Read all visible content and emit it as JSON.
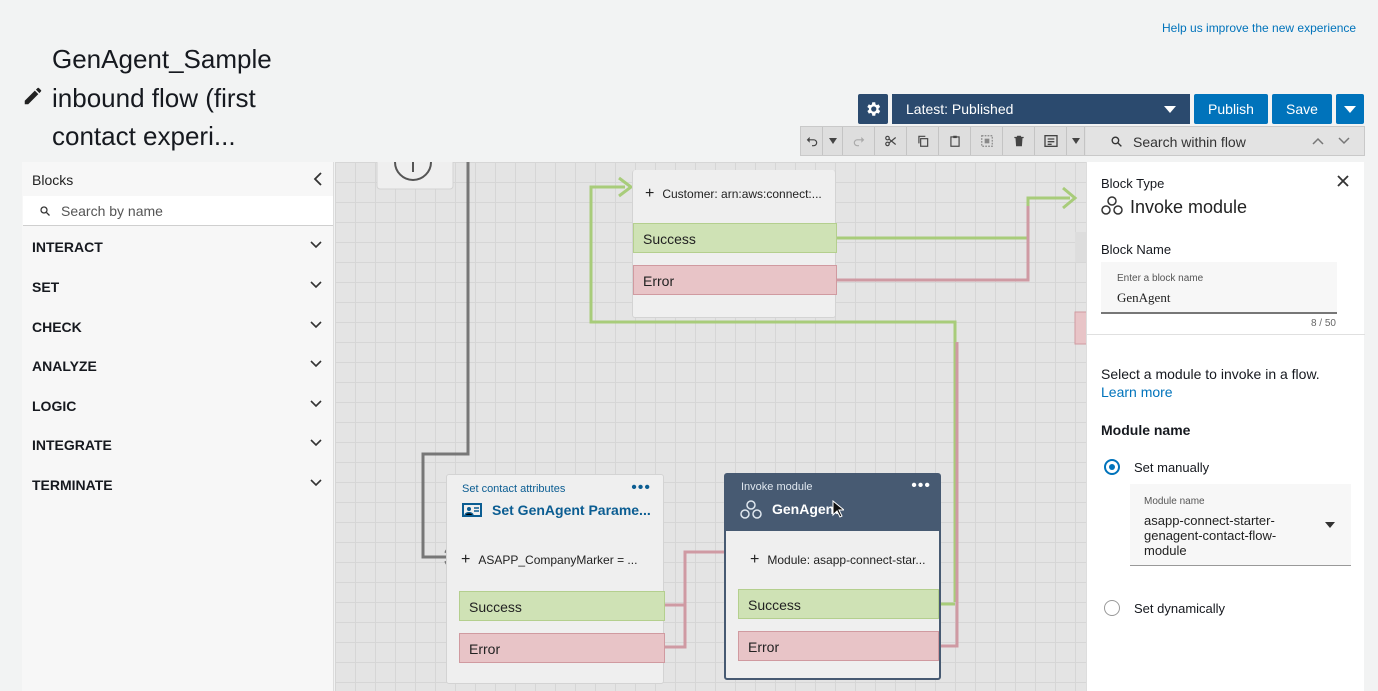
{
  "header": {
    "help_link": "Help us improve the new experience",
    "title_lines": [
      "GenAgent_Sample",
      "inbound flow (first",
      "contact experi..."
    ]
  },
  "toolbar": {
    "version_label": "Latest: Published",
    "publish_label": "Publish",
    "save_label": "Save",
    "search_placeholder": "Search within flow",
    "icons": [
      "undo-icon",
      "chevron-down-icon",
      "redo-icon",
      "cut-icon",
      "copy-icon",
      "paste-icon",
      "select-icon",
      "delete-icon",
      "notes-icon",
      "chevron-down-icon",
      "search-icon",
      "chevron-up-icon",
      "chevron-down-icon"
    ]
  },
  "blocks_panel": {
    "title": "Blocks",
    "search_placeholder": "Search by name",
    "categories": [
      "INTERACT",
      "SET",
      "CHECK",
      "ANALYZE",
      "LOGIC",
      "INTEGRATE",
      "TERMINATE"
    ]
  },
  "canvas": {
    "top_block": {
      "param": "Customer: arn:aws:connect:...",
      "success": "Success",
      "error": "Error"
    },
    "set_block": {
      "type": "Set contact attributes",
      "name": "Set GenAgent Parame...",
      "param": "ASAPP_CompanyMarker = ...",
      "success": "Success",
      "error": "Error"
    },
    "invoke_block": {
      "type": "Invoke module",
      "name": "GenAgent",
      "param": "Module: asapp-connect-star...",
      "success": "Success",
      "error": "Error"
    }
  },
  "properties": {
    "block_type_label": "Block Type",
    "block_type_value": "Invoke module",
    "block_name_label": "Block Name",
    "block_name_hint": "Enter a block name",
    "block_name_value": "GenAgent",
    "block_name_counter": "8 / 50",
    "description": "Select a module to invoke in a flow.",
    "learn_more": "Learn more",
    "module_name_label": "Module name",
    "set_manually": "Set manually",
    "module_select_label": "Module name",
    "module_select_value": "asapp-connect-starter-genagent-contact-flow-module",
    "set_dynamically": "Set dynamically"
  },
  "colors": {
    "primary_button": "#0073bb",
    "toolbar_dark": "#2b4a6e",
    "success_branch": "#cfe2b5",
    "error_branch": "#e8c4c7",
    "invoke_header": "#475a72"
  }
}
